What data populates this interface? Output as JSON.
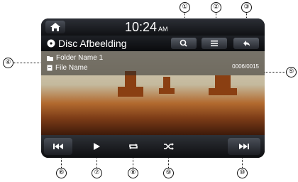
{
  "status_bar": {
    "time": "10:24",
    "ampm": "AM"
  },
  "header": {
    "title": "Disc Afbeelding"
  },
  "info": {
    "folder_name": "Folder Name 1",
    "file_name": "File Name",
    "counter": "0006/0015"
  },
  "callouts": [
    "①",
    "②",
    "③",
    "④",
    "⑤",
    "⑥",
    "⑦",
    "⑧",
    "⑨",
    "⑩"
  ],
  "icons": {
    "home": "home-icon",
    "disc": "disc-icon",
    "search": "search-icon",
    "list": "list-icon",
    "back": "back-icon",
    "folder": "folder-icon",
    "file": "file-icon",
    "previous": "previous-track-icon",
    "play": "play-icon",
    "repeat": "repeat-icon",
    "shuffle": "shuffle-icon",
    "next": "next-track-icon"
  }
}
